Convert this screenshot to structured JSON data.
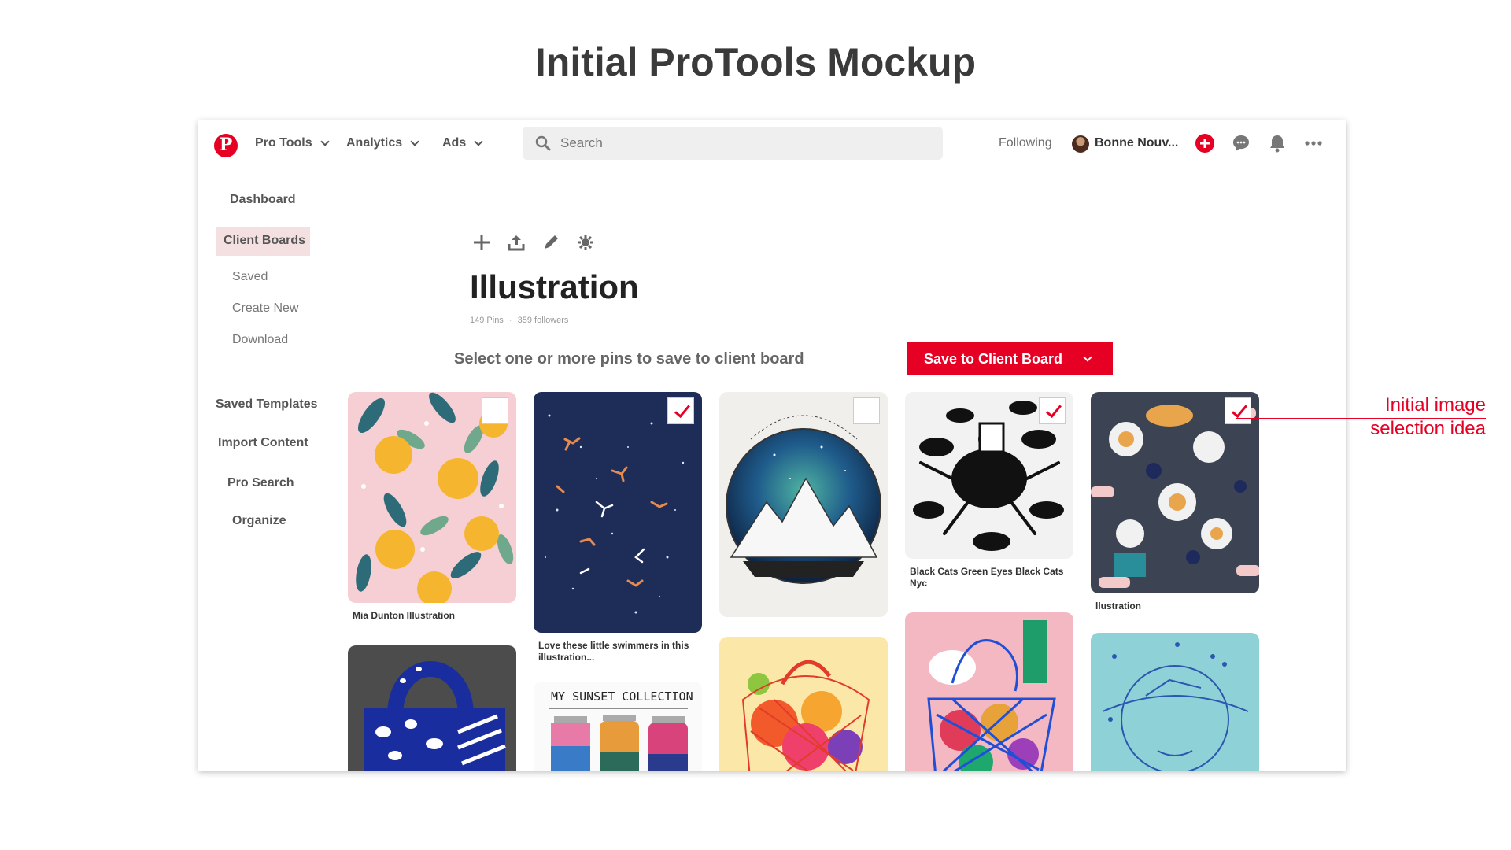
{
  "slide": {
    "title": "Initial ProTools Mockup"
  },
  "nav": {
    "logo": "P",
    "menus": [
      "Pro Tools",
      "Analytics",
      "Ads"
    ],
    "search_placeholder": "Search",
    "following": "Following",
    "username": "Bonne Nouv...",
    "icons": [
      "plus-circle-icon",
      "chat-icon",
      "bell-icon",
      "more-icon"
    ],
    "brand_color": "#e60023"
  },
  "sidebar": {
    "dashboard": "Dashboard",
    "client_boards": "Client Boards",
    "sub_items": [
      "Saved",
      "Create New",
      "Download"
    ],
    "saved_templates": "Saved Templates",
    "import_content": "Import Content",
    "pro_search": "Pro Search",
    "organize": "Organize"
  },
  "board": {
    "tools": [
      "plus-icon",
      "upload-icon",
      "pencil-icon",
      "settings-icon"
    ],
    "title": "Illustration",
    "pins": "149 Pins",
    "separator": "·",
    "followers": "359 followers",
    "prompt": "Select one or more pins to save to client board",
    "save_button": "Save to Client Board"
  },
  "pins": [
    {
      "caption": "Mia Dunton Illustration",
      "selected": false
    },
    {
      "caption": "Love these little swimmers in this illustration...",
      "selected": true
    },
    {
      "caption": "",
      "selected": false
    },
    {
      "caption": "Black Cats Green Eyes Black Cats Nyc",
      "selected": true
    },
    {
      "caption": "llustration",
      "selected": true
    }
  ],
  "jar_pin_text": "MY SUNSET COLLECTION",
  "annotation": {
    "line1": "Initial image",
    "line2": "selection idea"
  }
}
